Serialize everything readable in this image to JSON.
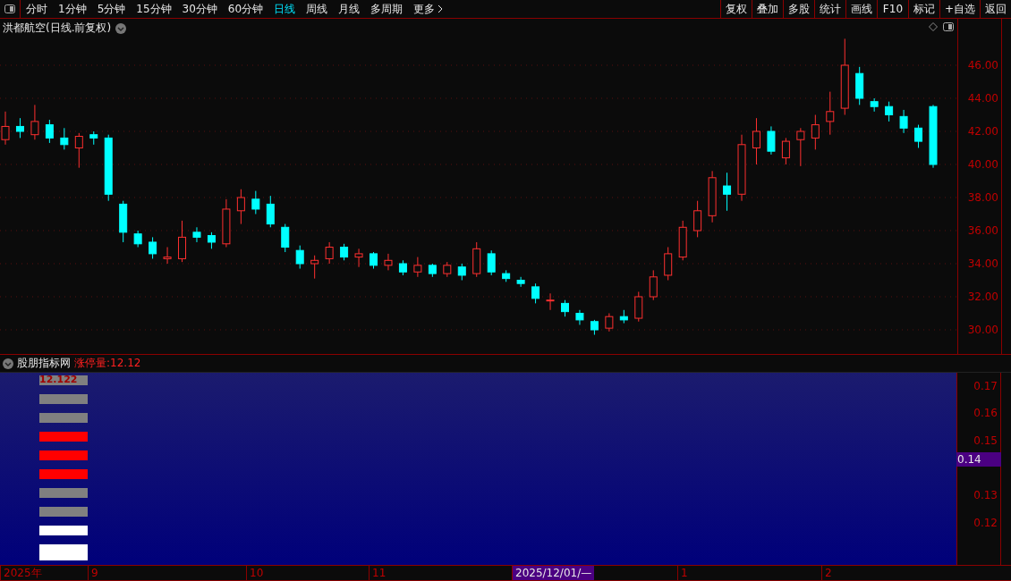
{
  "toolbar": {
    "periods": [
      {
        "label": "分时",
        "selected": false
      },
      {
        "label": "1分钟",
        "selected": false
      },
      {
        "label": "5分钟",
        "selected": false
      },
      {
        "label": "15分钟",
        "selected": false
      },
      {
        "label": "30分钟",
        "selected": false
      },
      {
        "label": "60分钟",
        "selected": false
      },
      {
        "label": "日线",
        "selected": true
      },
      {
        "label": "周线",
        "selected": false
      },
      {
        "label": "月线",
        "selected": false
      },
      {
        "label": "多周期",
        "selected": false
      },
      {
        "label": "更多",
        "selected": false
      }
    ],
    "actions": [
      "复权",
      "叠加",
      "多股",
      "统计",
      "画线",
      "F10",
      "标记",
      "+自选",
      "返回"
    ]
  },
  "main_chart": {
    "title": "洪都航空(日线.前复权)",
    "chart_data": {
      "type": "candlestick",
      "ylim": [
        28.54,
        48.81
      ],
      "grid": true,
      "yticks": [
        {
          "value": 46,
          "label": "46.00"
        },
        {
          "value": 44,
          "label": "44.00"
        },
        {
          "value": 42,
          "label": "42.00"
        },
        {
          "value": 40,
          "label": "40.00"
        },
        {
          "value": 38,
          "label": "38.00"
        },
        {
          "value": 36,
          "label": "36.00"
        },
        {
          "value": 34,
          "label": "34.00"
        },
        {
          "value": 32,
          "label": "32.00"
        },
        {
          "value": 30,
          "label": "30.00"
        }
      ],
      "ohlc": [
        [
          41.5,
          43.2,
          41.2,
          42.3
        ],
        [
          42.3,
          42.8,
          41.6,
          42.0
        ],
        [
          41.8,
          43.6,
          41.5,
          42.6
        ],
        [
          42.4,
          42.7,
          41.3,
          41.6
        ],
        [
          41.6,
          42.2,
          40.9,
          41.2
        ],
        [
          41.0,
          41.9,
          39.8,
          41.7
        ],
        [
          41.8,
          42.0,
          41.2,
          41.6
        ],
        [
          41.6,
          41.8,
          37.8,
          38.2
        ],
        [
          37.6,
          37.8,
          35.3,
          35.9
        ],
        [
          35.8,
          36.0,
          35.0,
          35.2
        ],
        [
          35.3,
          35.6,
          34.3,
          34.6
        ],
        [
          34.3,
          35.0,
          34.0,
          34.4
        ],
        [
          34.3,
          36.6,
          34.1,
          35.6
        ],
        [
          35.9,
          36.2,
          35.3,
          35.6
        ],
        [
          35.7,
          35.9,
          34.9,
          35.3
        ],
        [
          35.2,
          37.9,
          35.0,
          37.3
        ],
        [
          37.2,
          38.5,
          36.4,
          38.0
        ],
        [
          37.9,
          38.4,
          37.0,
          37.3
        ],
        [
          37.6,
          38.1,
          36.2,
          36.4
        ],
        [
          36.2,
          36.4,
          34.7,
          35.0
        ],
        [
          34.8,
          35.1,
          33.7,
          34.0
        ],
        [
          34.0,
          34.5,
          33.1,
          34.2
        ],
        [
          34.3,
          35.3,
          34.0,
          35.0
        ],
        [
          35.0,
          35.2,
          34.2,
          34.4
        ],
        [
          34.4,
          34.9,
          33.8,
          34.6
        ],
        [
          34.6,
          34.7,
          33.7,
          33.9
        ],
        [
          33.9,
          34.6,
          33.6,
          34.2
        ],
        [
          34.0,
          34.2,
          33.3,
          33.5
        ],
        [
          33.5,
          34.4,
          33.2,
          33.9
        ],
        [
          33.9,
          34.0,
          33.2,
          33.4
        ],
        [
          33.4,
          34.1,
          33.2,
          33.9
        ],
        [
          33.8,
          34.0,
          33.0,
          33.3
        ],
        [
          33.4,
          35.3,
          33.2,
          34.9
        ],
        [
          34.6,
          34.8,
          33.3,
          33.5
        ],
        [
          33.4,
          33.6,
          32.9,
          33.1
        ],
        [
          33.0,
          33.2,
          32.6,
          32.8
        ],
        [
          32.6,
          32.8,
          31.6,
          31.9
        ],
        [
          31.8,
          32.2,
          31.2,
          31.8
        ],
        [
          31.6,
          31.8,
          30.8,
          31.1
        ],
        [
          31.0,
          31.2,
          30.3,
          30.6
        ],
        [
          30.5,
          30.6,
          29.7,
          30.0
        ],
        [
          30.1,
          31.0,
          29.9,
          30.8
        ],
        [
          30.8,
          31.2,
          30.4,
          30.6
        ],
        [
          30.7,
          32.3,
          30.5,
          32.0
        ],
        [
          32.0,
          33.6,
          31.8,
          33.2
        ],
        [
          33.3,
          35.0,
          33.0,
          34.6
        ],
        [
          34.4,
          36.6,
          34.2,
          36.2
        ],
        [
          36.0,
          37.8,
          35.6,
          37.2
        ],
        [
          36.9,
          39.6,
          36.5,
          39.2
        ],
        [
          38.7,
          39.5,
          37.2,
          38.2
        ],
        [
          38.2,
          41.8,
          37.8,
          41.2
        ],
        [
          41.0,
          42.8,
          40.0,
          42.0
        ],
        [
          42.0,
          42.3,
          40.6,
          40.8
        ],
        [
          40.4,
          41.6,
          40.0,
          41.4
        ],
        [
          41.5,
          42.2,
          39.9,
          42.0
        ],
        [
          41.6,
          43.0,
          40.9,
          42.4
        ],
        [
          42.6,
          44.4,
          41.8,
          43.2
        ],
        [
          43.4,
          47.6,
          43.0,
          46.0
        ],
        [
          45.5,
          45.9,
          43.6,
          44.0
        ],
        [
          43.8,
          44.0,
          43.2,
          43.5
        ],
        [
          43.5,
          43.8,
          42.6,
          43.0
        ],
        [
          42.9,
          43.3,
          41.9,
          42.2
        ],
        [
          42.2,
          42.4,
          41.0,
          41.4
        ],
        [
          43.5,
          43.6,
          39.8,
          40.0
        ]
      ]
    }
  },
  "indicator": {
    "name": "股朋指标网",
    "formula": "涨停量:12.12",
    "y_ticks": [
      "0.17",
      "0.16",
      "0.15",
      "0.13",
      "0.12"
    ],
    "cursor_value": "0.14",
    "bars": [
      {
        "color": "#808080",
        "label": "12.122"
      },
      {
        "color": "#808080"
      },
      {
        "color": "#808080"
      },
      {
        "color": "#ff0000"
      },
      {
        "color": "#ff0000"
      },
      {
        "color": "#ff0000"
      },
      {
        "color": "#808080"
      },
      {
        "color": "#808080"
      },
      {
        "color": "#ffffff"
      },
      {
        "color": "#ffffff"
      }
    ]
  },
  "time_axis": {
    "labels": [
      {
        "text": "2025年",
        "selected": false
      },
      {
        "text": "9",
        "selected": false
      },
      {
        "text": "10",
        "selected": false
      },
      {
        "text": "11",
        "selected": false
      },
      {
        "text": "2025/12/01/—",
        "selected": true
      },
      {
        "text": "1",
        "selected": false
      },
      {
        "text": "2",
        "selected": false
      }
    ]
  }
}
